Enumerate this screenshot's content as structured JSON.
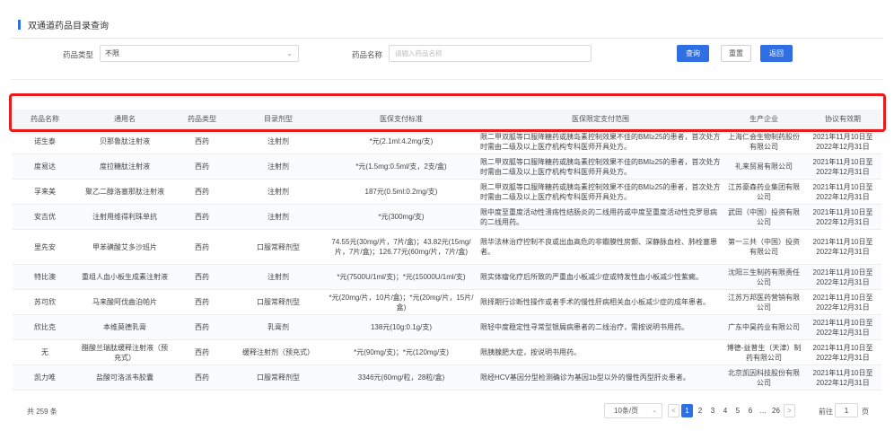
{
  "page": {
    "title": "双通道药品目录查询"
  },
  "filters": {
    "type_label": "药品类型",
    "type_value": "不限",
    "name_label": "药品名称",
    "name_placeholder": "请输入药品名称",
    "name_value": "",
    "query_label": "查询",
    "reset_label": "重置",
    "back_label": "返回"
  },
  "table": {
    "columns": [
      "药品名称",
      "通用名",
      "药品类型",
      "目录剂型",
      "医保支付标准",
      "医保限定支付范围",
      "生产企业",
      "协议有效期"
    ],
    "rows": [
      [
        "诺生泰",
        "贝那鲁肽注射液",
        "西药",
        "注射剂",
        "*元(2.1ml:4.2mg/支)",
        "限二甲双胍等口服降糖药或胰岛素控制效果不佳的BMI≥25的患者，首次处方时需由二级及以上医疗机构专科医师开具处方。",
        "上海仁会生物制药股份有限公司",
        "2021年11月10日至2022年12月31日"
      ],
      [
        "度易达",
        "度拉糖肽注射液",
        "西药",
        "注射剂",
        "*元(1.5mg:0.5ml/支，2支/盒)",
        "限二甲双胍等口服降糖药或胰岛素控制效果不佳的BMI≥25的患者，首次处方时需由二级及以上医疗机构专科医师开具处方。",
        "礼来贸易有限公司",
        "2021年11月10日至2022年12月31日"
      ],
      [
        "孚来美",
        "聚乙二醇洛塞那肽注射液",
        "西药",
        "注射剂",
        "187元(0.5ml:0.2mg/支)",
        "限二甲双胍等口服降糖药或胰岛素控制效果不佳的BMI≥25的患者，首次处方时需由二级及以上医疗机构专科医师开具处方。",
        "江苏豪森药业集团有限公司",
        "2021年11月10日至2022年12月31日"
      ],
      [
        "安吉优",
        "注射用维得利珠单抗",
        "西药",
        "注射剂",
        "*元(300mg/支)",
        "限中度至重度活动性溃疡性结肠炎的二线用药或中度至重度活动性克罗恩病的二线用药。",
        "武田（中国）投资有限公司",
        "2021年11月10日至2022年12月31日"
      ],
      [
        "里先安",
        "甲苯磺酸艾多沙班片",
        "西药",
        "口服常释剂型",
        "74.55元(30mg/片，7片/盒)；43.82元(15mg/片，7片/盒)；126.77元(60mg/片，7片/盒)",
        "限华法林治疗控制不良或出血高危的非瓣膜性房颤、深静脉血栓、肺栓塞患者。",
        "第一三共（中国）投资有限公司",
        "2021年11月10日至2022年12月31日"
      ],
      [
        "特比澳",
        "重组人血小板生成素注射液",
        "西药",
        "注射剂",
        "*元(7500U/1ml/支)；*元(15000U/1ml/支)",
        "限实体瘤化疗后所致的严重血小板减少症或特发性血小板减少性紫癜。",
        "沈阳三生制药有限责任公司",
        "2021年11月10日至2022年12月31日"
      ],
      [
        "苏可欣",
        "马来酸阿伐曲泊帕片",
        "西药",
        "口服常释剂型",
        "*元(20mg/片，10片/盒)；*元(20mg/片，15片/盒)",
        "限择期行诊断性操作或者手术的慢性肝病相关血小板减少症的成年患者。",
        "江苏万邦医药营销有限公司",
        "2021年11月10日至2022年12月31日"
      ],
      [
        "欣比克",
        "本维莫德乳膏",
        "西药",
        "乳膏剂",
        "138元(10g:0.1g/支)",
        "限轻中度稳定性寻常型银屑病患者的二线治疗，需按说明书用药。",
        "广东中昊药业有限公司",
        "2021年11月10日至2022年12月31日"
      ],
      [
        "无",
        "醋酸兰瑞肽缓释注射液（预充式）",
        "西药",
        "缓释注射剂（预充式）",
        "*元(90mg/支)；*元(120mg/支)",
        "限胰腺肥大症，按说明书用药。",
        "博德-益普生（天津）制药有限公司",
        "2021年11月10日至2022年12月31日"
      ],
      [
        "凯力唯",
        "盐酸可洛派韦胶囊",
        "西药",
        "口服常释剂型",
        "3346元(60mg/粒，28粒/盒)",
        "限经HCV基因分型检测确诊为基因1b型以外的慢性丙型肝炎患者。",
        "北京凯因科技股份有限公司",
        "2021年11月10日至2022年12月31日"
      ]
    ]
  },
  "pagination": {
    "total_text": "共 259 条",
    "page_size_text": "10条/页",
    "prev_symbol": "<",
    "pages": [
      "1",
      "2",
      "3",
      "4",
      "5",
      "6",
      "...",
      "26"
    ],
    "current_page": 1,
    "next_symbol": ">",
    "goto_label": "前往",
    "goto_value": "1",
    "goto_suffix": "页"
  }
}
